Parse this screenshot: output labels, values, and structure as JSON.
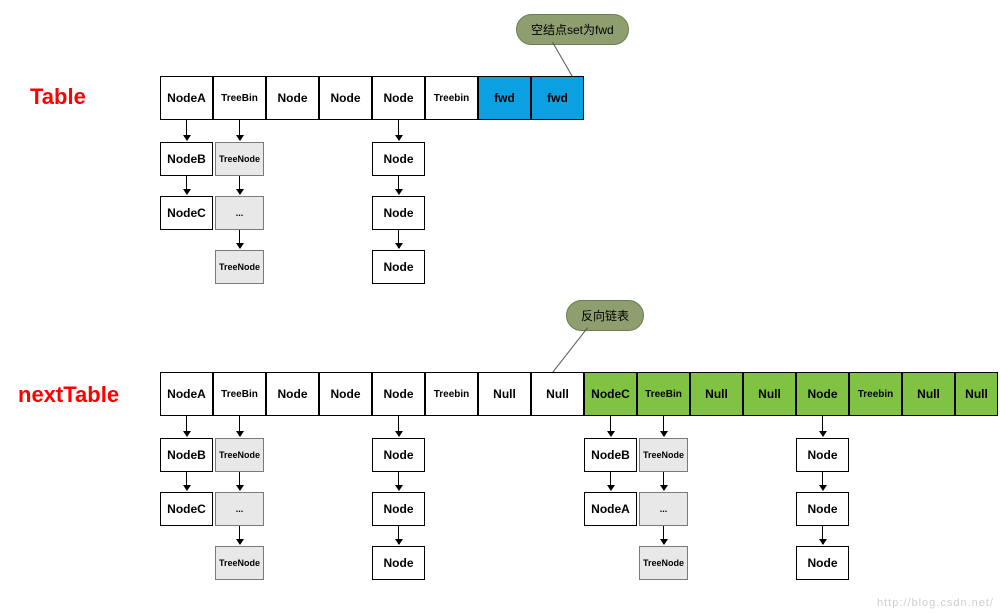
{
  "callouts": {
    "top": "空结点set为fwd",
    "mid": "反向链表"
  },
  "titles": {
    "table": "Table",
    "nextTable": "nextTable"
  },
  "watermark": "http://blog.csdn.net/",
  "table": {
    "row": [
      "NodeA",
      "TreeBin",
      "Node",
      "Node",
      "Node",
      "Treebin",
      "fwd",
      "fwd"
    ],
    "chains": {
      "c0": [
        "NodeB",
        "NodeC"
      ],
      "c1": [
        "TreeNode",
        "...",
        "TreeNode"
      ],
      "c4": [
        "Node",
        "Node",
        "Node"
      ]
    }
  },
  "nextTable": {
    "row": [
      "NodeA",
      "TreeBin",
      "Node",
      "Node",
      "Node",
      "Treebin",
      "Null",
      "Null",
      "NodeC",
      "TreeBin",
      "Null",
      "Null",
      "Node",
      "Treebin",
      "Null",
      "Null"
    ],
    "chains": {
      "c0": [
        "NodeB",
        "NodeC"
      ],
      "c1": [
        "TreeNode",
        "...",
        "TreeNode"
      ],
      "c4": [
        "Node",
        "Node",
        "Node"
      ],
      "c8": [
        "NodeB",
        "NodeA"
      ],
      "c9": [
        "TreeNode",
        "...",
        "TreeNode"
      ],
      "c12": [
        "Node",
        "Node",
        "Node"
      ]
    }
  }
}
